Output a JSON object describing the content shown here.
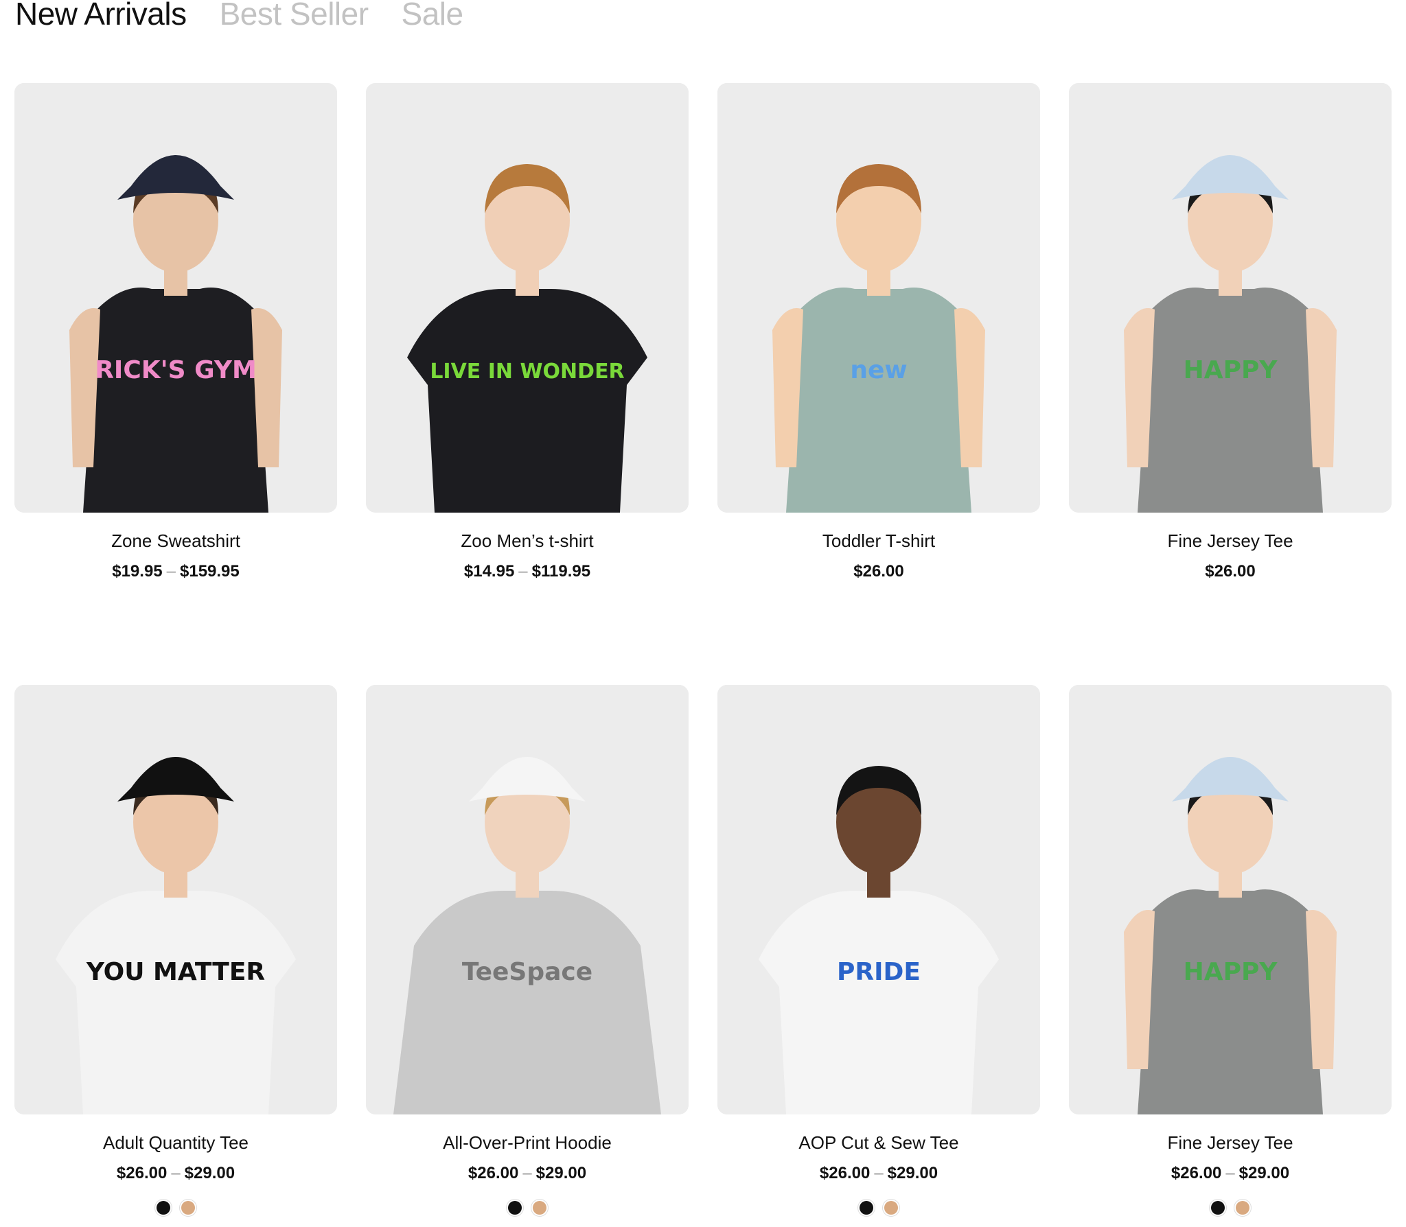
{
  "tabs": [
    {
      "label": "New Arrivals",
      "active": true
    },
    {
      "label": "Best Seller",
      "active": false
    },
    {
      "label": "Sale",
      "active": false
    }
  ],
  "products": [
    {
      "name": "Zone Sweatshirt",
      "price_min": "$19.95",
      "price_max": "$159.95",
      "range_sep": "–",
      "image": {
        "shirt": "#1e1e22",
        "print": "RICK'S GYM",
        "print_color": "#f08bc8",
        "hat": "#23283a",
        "style": "tank"
      },
      "swatches": []
    },
    {
      "name": "Zoo Men’s t-shirt",
      "price_min": "$14.95",
      "price_max": "$119.95",
      "range_sep": "–",
      "image": {
        "shirt": "#1c1c20",
        "print": "LIVE IN WONDER",
        "print_color": "#7ad93a",
        "hat": "",
        "style": "tee"
      },
      "swatches": []
    },
    {
      "name": "Toddler T-shirt",
      "price_min": "$26.00",
      "price_max": "",
      "range_sep": "",
      "image": {
        "shirt": "#9bb5ad",
        "print": "new",
        "print_color": "#5aa0e6",
        "hat": "",
        "style": "tank"
      },
      "swatches": []
    },
    {
      "name": "Fine Jersey Tee",
      "price_min": "$26.00",
      "price_max": "",
      "range_sep": "",
      "image": {
        "shirt": "#8b8d8c",
        "print": "HAPPY",
        "print_color": "#49a84f",
        "hat": "#c7d9ea",
        "style": "tank"
      },
      "swatches": []
    },
    {
      "name": "Adult Quantity Tee",
      "price_min": "$26.00",
      "price_max": "$29.00",
      "range_sep": "–",
      "image": {
        "shirt": "#f3f3f3",
        "print": "YOU MATTER",
        "print_color": "#111111",
        "hat": "#111111",
        "style": "tee"
      },
      "swatches": [
        {
          "name": "black",
          "color": "#111111"
        },
        {
          "name": "tan",
          "color": "#d9a980"
        }
      ]
    },
    {
      "name": "All-Over-Print Hoodie",
      "price_min": "$26.00",
      "price_max": "$29.00",
      "range_sep": "–",
      "image": {
        "shirt": "#c9c9c9",
        "print": "TeeSpace",
        "print_color": "#777777",
        "hat": "#f5f5f5",
        "style": "sweat"
      },
      "swatches": [
        {
          "name": "black",
          "color": "#111111"
        },
        {
          "name": "tan",
          "color": "#d9a980"
        }
      ]
    },
    {
      "name": "AOP Cut & Sew Tee",
      "price_min": "$26.00",
      "price_max": "$29.00",
      "range_sep": "–",
      "image": {
        "shirt": "#f5f5f5",
        "print": "PRIDE",
        "print_color": "#2a63c9",
        "hat": "",
        "style": "tee"
      },
      "swatches": [
        {
          "name": "black",
          "color": "#111111"
        },
        {
          "name": "tan",
          "color": "#d9a980"
        }
      ]
    },
    {
      "name": "Fine Jersey Tee",
      "price_min": "$26.00",
      "price_max": "$29.00",
      "range_sep": "–",
      "image": {
        "shirt": "#8b8d8c",
        "print": "HAPPY",
        "print_color": "#49a84f",
        "hat": "#c7d9ea",
        "style": "tank"
      },
      "swatches": [
        {
          "name": "black",
          "color": "#111111"
        },
        {
          "name": "tan",
          "color": "#d9a980"
        }
      ]
    }
  ]
}
